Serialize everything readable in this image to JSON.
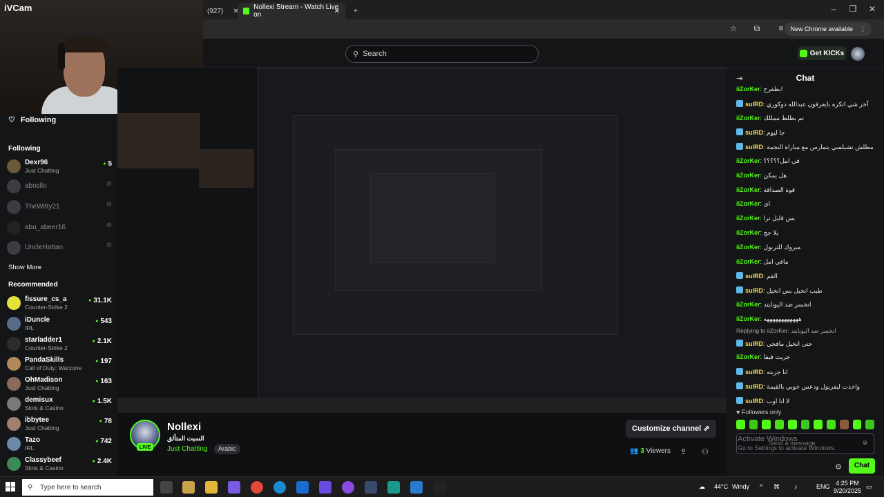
{
  "browser": {
    "tabs": [
      {
        "label": "(927)"
      },
      {
        "label": "Nollexi Stream - Watch Live on"
      }
    ],
    "new_chrome": "New Chrome available"
  },
  "webcam": {
    "label": "iVCam"
  },
  "header": {
    "search_placeholder": "Search",
    "get_kicks": "Get KICKs"
  },
  "sidebar": {
    "following_title": "Following",
    "following_header": "Following",
    "following": [
      {
        "name": "Dexr96",
        "sub": "Just Chatting",
        "count": "5",
        "live": true
      },
      {
        "name": "abosllo",
        "sub": "",
        "count": "",
        "live": false
      },
      {
        "name": "TheWitty21",
        "sub": "",
        "count": "",
        "live": false
      },
      {
        "name": "abu_abeer16",
        "sub": "",
        "count": "",
        "live": false
      },
      {
        "name": "UncleHattan",
        "sub": "",
        "count": "",
        "live": false
      }
    ],
    "show_more": "Show More",
    "recommended_header": "Recommended",
    "recommended": [
      {
        "name": "fissure_cs_a",
        "sub": "Counter-Strike 2",
        "count": "31.1K"
      },
      {
        "name": "iDuncle",
        "sub": "IRL",
        "count": "543"
      },
      {
        "name": "starladder1",
        "sub": "Counter-Strike 2",
        "count": "2.1K"
      },
      {
        "name": "PandaSkills",
        "sub": "Call of Duty: Warzone",
        "count": "197"
      },
      {
        "name": "OhMadison",
        "sub": "Just Chatting",
        "count": "163"
      },
      {
        "name": "demisux",
        "sub": "Slots & Casino",
        "count": "1.5K"
      },
      {
        "name": "ibbytee",
        "sub": "Just Chatting",
        "count": "78"
      },
      {
        "name": "Tazo",
        "sub": "IRL",
        "count": "742"
      },
      {
        "name": "Classybeef",
        "sub": "Slots & Casino",
        "count": "2.4K"
      }
    ]
  },
  "stream": {
    "name": "Nollexi",
    "title": "السبت المتألق",
    "category": "Just Chatting",
    "language": "Arabic",
    "live": "LIVE",
    "customize": "Customize channel",
    "viewers_count": "3",
    "viewers_label": "Viewers"
  },
  "chat": {
    "title": "Chat",
    "messages": [
      {
        "user": "iiZorKer",
        "color": "green",
        "text": "بطفرح!",
        "icon": false
      },
      {
        "user": "sulRD",
        "color": "yellow",
        "text": "آخر شي اتكره بايعرفون عبدالله دوكوري",
        "icon": true
      },
      {
        "user": "iiZorKer",
        "color": "green",
        "text": "تم بطلط ممللك",
        "icon": false
      },
      {
        "user": "sulRD",
        "color": "yellow",
        "text": "جا ليوم",
        "icon": true
      },
      {
        "user": "sulRD",
        "color": "yellow",
        "text": "مطلش تشيلسي يتمارس مع مباراة النجمة",
        "icon": true
      },
      {
        "user": "iiZorKer",
        "color": "green",
        "text": "في امل؟؟؟؟؟",
        "icon": false
      },
      {
        "user": "iiZorKer",
        "color": "green",
        "text": "هل يمكن",
        "icon": false
      },
      {
        "user": "iiZorKer",
        "color": "green",
        "text": "قوة الصداقة",
        "icon": false
      },
      {
        "user": "iiZorKer",
        "color": "green",
        "text": "اي",
        "icon": false
      },
      {
        "user": "iiZorKer",
        "color": "green",
        "text": "بس قليل ترا",
        "icon": false
      },
      {
        "user": "iiZorKer",
        "color": "green",
        "text": "يلا جج",
        "icon": false
      },
      {
        "user": "iiZorKer",
        "color": "green",
        "text": "مبروك للتربول",
        "icon": false
      },
      {
        "user": "iiZorKer",
        "color": "green",
        "text": "مافي امل",
        "icon": false
      },
      {
        "user": "sulRD",
        "color": "yellow",
        "text": "القم",
        "icon": true
      },
      {
        "user": "sulRD",
        "color": "yellow",
        "text": "طيب انخيل بس انخيل",
        "icon": true
      },
      {
        "user": "iiZorKer",
        "color": "green",
        "text": "انخسر ضد اليونايتد",
        "icon": false
      },
      {
        "user": "iiZorKer",
        "color": "green",
        "text": "ههههههههههههه",
        "icon": false
      },
      {
        "user": "sulRD",
        "color": "yellow",
        "text": "حتى انخيل مافجي",
        "icon": true
      },
      {
        "user": "iiZorKer",
        "color": "green",
        "text": "جريت فيفا",
        "icon": false
      },
      {
        "user": "sulRD",
        "color": "yellow",
        "text": "انا جربته",
        "icon": true
      },
      {
        "user": "sulRD",
        "color": "yellow",
        "text": "واخذت ليفربول ودعس خوبي بالقيمة",
        "icon": true
      },
      {
        "user": "sulRD",
        "color": "yellow",
        "text": "لا انا اوب",
        "icon": true
      }
    ],
    "reply": "Replying to iiZorKer: انخسر ضد اليونايتد",
    "followers_only": "Followers only",
    "input_placeholder": "Send a message",
    "activate_line1": "Activate Windows",
    "activate_line2": "Go to Settings to activate Windows.",
    "send": "Chat"
  },
  "taskbar": {
    "search_placeholder": "Type here to search",
    "weather_temp": "44°C",
    "weather_label": "Windy",
    "lang": "ENG",
    "time": "4:25 PM",
    "date": "9/20/2025"
  }
}
